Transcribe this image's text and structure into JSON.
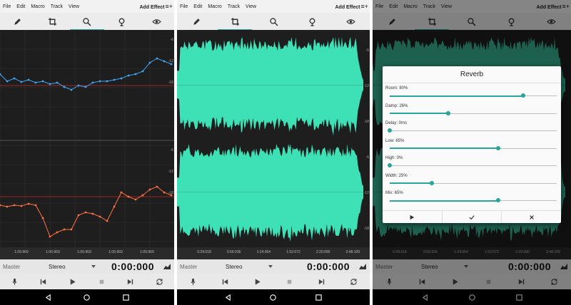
{
  "colors": {
    "accent": "#26a69a",
    "waveform": "#3ee0b5",
    "pitch_blue": "#42a5f5",
    "pitch_orange": "#ff7043",
    "red_line": "#c62828"
  },
  "screens": [
    {
      "menu": [
        "File",
        "Edit",
        "Macro",
        "Track",
        "View"
      ],
      "add_effect": "Add Effect",
      "tools": [
        "pencil-icon",
        "crop-icon",
        "zoom-icon",
        "pitch-icon",
        "eye-icon"
      ],
      "active_tool": 2,
      "time_labels": [
        "1:05:969",
        "1:05:969",
        "1:05:969",
        "1:05:969",
        "1:05:969"
      ],
      "db_labels": [
        "-6",
        "-12",
        "-18",
        "-6",
        "-12",
        "-18"
      ],
      "master": "Master",
      "stereo": "Stereo",
      "time": "0:00:000"
    },
    {
      "menu": [
        "File",
        "Edit",
        "Macro",
        "Track",
        "View"
      ],
      "add_effect": "Add Effect",
      "tools": [
        "pencil-icon",
        "crop-icon",
        "zoom-icon",
        "pitch-icon",
        "eye-icon"
      ],
      "active_tool": 1,
      "time_labels": [
        "0:29:018",
        "0:56:036",
        "1:24:054",
        "1:52:072",
        "2:20:090",
        "2:48:109"
      ],
      "db_labels": [
        "-6",
        "-12",
        "-18",
        "-6",
        "-12",
        "-18"
      ],
      "master": "Master",
      "stereo": "Stereo",
      "time": "0:00:000"
    },
    {
      "menu": [
        "File",
        "Edit",
        "Macro",
        "Track",
        "View"
      ],
      "add_effect": "Add Effect",
      "tools": [
        "pencil-icon",
        "crop-icon",
        "zoom-icon",
        "pitch-icon",
        "eye-icon"
      ],
      "active_tool": 1,
      "time_labels": [
        "0:28:018",
        "0:56:036",
        "1:24:054",
        "1:52:072",
        "2:20:090",
        "2:48:109"
      ],
      "master": "Master",
      "stereo": "Stereo",
      "time": "0:00:000"
    }
  ],
  "reverb": {
    "title": "Reverb",
    "params": [
      {
        "label": "Room: 80%",
        "value": 0.8
      },
      {
        "label": "Damp: 26%",
        "value": 0.35
      },
      {
        "label": "Delay: 0ms",
        "value": 0.0
      },
      {
        "label": "Low: 65%",
        "value": 0.65
      },
      {
        "label": "High: 0%",
        "value": 0.0
      },
      {
        "label": "Width: 25%",
        "value": 0.25
      },
      {
        "label": "Mix: 65%",
        "value": 0.65
      }
    ],
    "buttons": [
      "play-icon",
      "check-icon",
      "close-icon"
    ]
  }
}
